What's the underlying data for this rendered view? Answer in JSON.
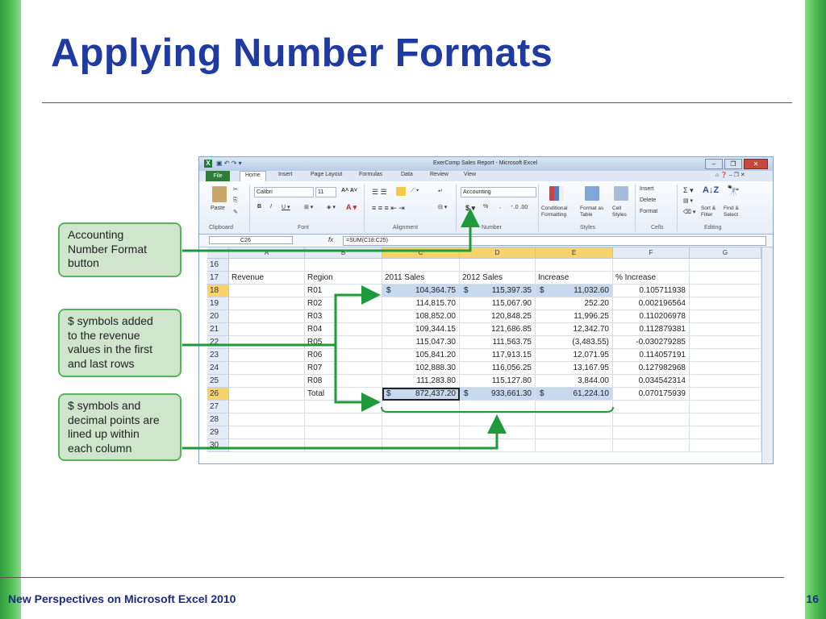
{
  "slide": {
    "title": "Applying Number Formats",
    "footer": "New Perspectives on Microsoft Excel 2010",
    "page_number": "16"
  },
  "excel": {
    "window_title": "ExerComp Sales Report - Microsoft Excel",
    "tabs": [
      "File",
      "Home",
      "Insert",
      "Page Layout",
      "Formulas",
      "Data",
      "Review",
      "View"
    ],
    "active_tab": "Home",
    "ribbon": {
      "font_name": "Calibri",
      "font_size": "11",
      "number_format": "Accounting",
      "group_labels": [
        "Clipboard",
        "Font",
        "Alignment",
        "Number",
        "Styles",
        "Cells",
        "Editing"
      ],
      "paste": "Paste",
      "conditional_formatting": "Conditional Formatting",
      "format_as_table": "Format as Table",
      "cell_styles": "Cell Styles",
      "insert": "Insert",
      "delete": "Delete",
      "format": "Format",
      "sort_filter": "Sort & Filter",
      "find_select": "Find & Select"
    },
    "name_box": "C26",
    "fx_label": "fx",
    "formula": "=SUM(C18:C25)",
    "columns": [
      "A",
      "B",
      "C",
      "D",
      "E",
      "F",
      "G"
    ],
    "rows": [
      {
        "n": "16",
        "a": "",
        "b": "",
        "c": "",
        "d": "",
        "e": "",
        "f": ""
      },
      {
        "n": "17",
        "a": "Revenue",
        "b": "Region",
        "c": "2011 Sales",
        "d": "2012 Sales",
        "e": "Increase",
        "f": "% Increase"
      },
      {
        "n": "18",
        "a": "",
        "b": "R01",
        "c": "104,364.75",
        "d": "115,397.35",
        "e": "11,032.60",
        "f": "0.105711938"
      },
      {
        "n": "19",
        "a": "",
        "b": "R02",
        "c": "114,815.70",
        "d": "115,067.90",
        "e": "252.20",
        "f": "0.002196564"
      },
      {
        "n": "20",
        "a": "",
        "b": "R03",
        "c": "108,852.00",
        "d": "120,848.25",
        "e": "11,996.25",
        "f": "0.110206978"
      },
      {
        "n": "21",
        "a": "",
        "b": "R04",
        "c": "109,344.15",
        "d": "121,686.85",
        "e": "12,342.70",
        "f": "0.112879381"
      },
      {
        "n": "22",
        "a": "",
        "b": "R05",
        "c": "115,047.30",
        "d": "111,563.75",
        "e": "(3,483.55)",
        "f": "-0.030279285"
      },
      {
        "n": "23",
        "a": "",
        "b": "R06",
        "c": "105,841.20",
        "d": "117,913.15",
        "e": "12,071.95",
        "f": "0.114057191"
      },
      {
        "n": "24",
        "a": "",
        "b": "R07",
        "c": "102,888.30",
        "d": "116,056.25",
        "e": "13,167.95",
        "f": "0.127982968"
      },
      {
        "n": "25",
        "a": "",
        "b": "R08",
        "c": "111,283.80",
        "d": "115,127.80",
        "e": "3,844.00",
        "f": "0.034542314"
      },
      {
        "n": "26",
        "a": "",
        "b": "Total",
        "c": "872,437.20",
        "d": "933,661.30",
        "e": "61,224.10",
        "f": "0.070175939"
      },
      {
        "n": "27",
        "a": "",
        "b": "",
        "c": "",
        "d": "",
        "e": "",
        "f": ""
      },
      {
        "n": "28",
        "a": "",
        "b": "",
        "c": "",
        "d": "",
        "e": "",
        "f": ""
      },
      {
        "n": "29",
        "a": "",
        "b": "",
        "c": "",
        "d": "",
        "e": "",
        "f": ""
      },
      {
        "n": "30",
        "a": "",
        "b": "",
        "c": "",
        "d": "",
        "e": "",
        "f": ""
      }
    ],
    "currency_symbol": "$"
  },
  "callouts": [
    {
      "lines": [
        "Accounting",
        "Number Format",
        "button"
      ]
    },
    {
      "lines": [
        "$ symbols added",
        "to the revenue",
        "values in the first",
        "and last rows"
      ]
    },
    {
      "lines": [
        "$ symbols and",
        "decimal points are",
        "lined up within",
        "each column"
      ]
    }
  ],
  "colors": {
    "title": "#1f3aa0",
    "accent_green": "#58b65a",
    "callout_fill": "#cfe6cd",
    "selection": "#c6d9ef"
  }
}
